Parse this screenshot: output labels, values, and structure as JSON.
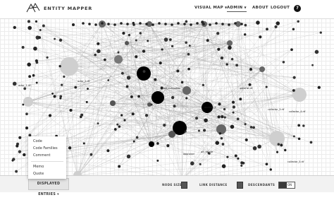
{
  "app": {
    "title": "ENTITY MAPPER"
  },
  "nav": {
    "visual_map": "VISUAL MAP",
    "admin": "ADMIN",
    "about": "ABOUT",
    "logout": "LOGOUT",
    "help": "?"
  },
  "graph_labels": [
    "actor_1.rtf",
    "actor_2.rtf",
    "gallerist.rtf",
    "collector_4.rtf",
    "art_evaluation",
    "auction_1",
    "collector_3.rtf",
    "art_estate",
    "appraiser",
    "collector_5.rtf"
  ],
  "dropdown": {
    "items": [
      "Code",
      "Code Families",
      "Comment",
      "Memo",
      "Quote"
    ]
  },
  "bottom": {
    "displayed_entries": "DISPLAYED ENTRIES",
    "node_size": "NODE SIZE",
    "link_distance": "LINK DISTANCE",
    "descendants": "DESCENDANTS",
    "toggle_on": "ON"
  },
  "colors": {
    "accent": "#111111",
    "node_large_light": "#c8c8c8",
    "node_dark": "#000000",
    "link": "#9a9a9a"
  }
}
